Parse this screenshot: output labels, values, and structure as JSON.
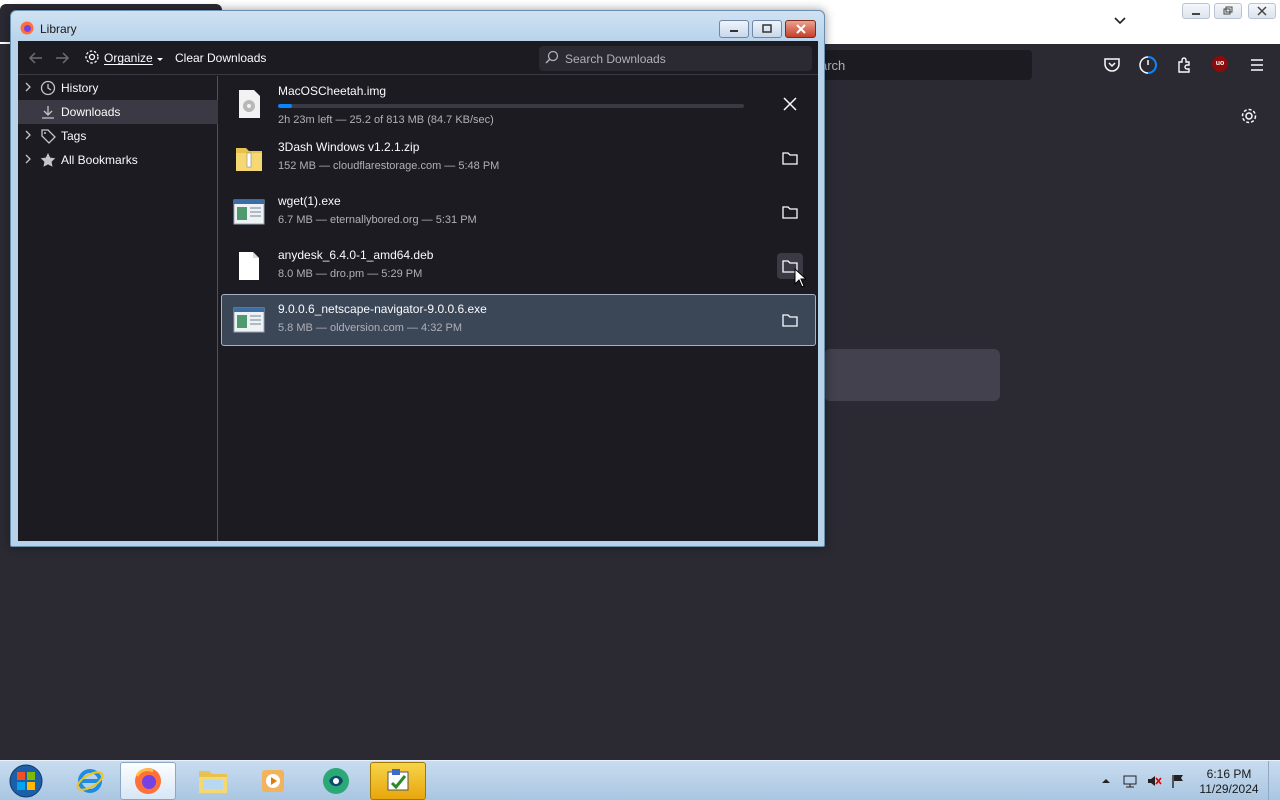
{
  "background_browser": {
    "url_bar_text": "arch",
    "icons": [
      "chevron-down-icon",
      "pocket-icon",
      "firefox-account-icon",
      "extensions-icon",
      "ublock-icon",
      "hamburger-menu-icon",
      "gear-icon"
    ],
    "ublock_badge": "uo"
  },
  "library_window": {
    "title": "Library",
    "toolbar": {
      "organize_label": "Organize",
      "clear_downloads_label": "Clear Downloads",
      "search_placeholder": "Search Downloads"
    },
    "sidebar": {
      "items": [
        {
          "label": "History",
          "icon": "clock-icon",
          "expandable": true,
          "selected": false
        },
        {
          "label": "Downloads",
          "icon": "download-icon",
          "expandable": false,
          "selected": true
        },
        {
          "label": "Tags",
          "icon": "tag-icon",
          "expandable": true,
          "selected": false
        },
        {
          "label": "All Bookmarks",
          "icon": "star-icon",
          "expandable": true,
          "selected": false
        }
      ]
    },
    "downloads": [
      {
        "name": "MacOSCheetah.img",
        "status": "2h 23m left — 25.2 of 813 MB (84.7 KB/sec)",
        "progress_percent": 3.1,
        "in_progress": true,
        "action": "cancel",
        "icon": "disk-image-icon"
      },
      {
        "name": "3Dash Windows v1.2.1.zip",
        "status": "152 MB — cloudflarestorage.com — 5:48 PM",
        "in_progress": false,
        "action": "show-in-folder",
        "icon": "zip-folder-icon"
      },
      {
        "name": "wget(1).exe",
        "status": "6.7 MB — eternallybored.org — 5:31 PM",
        "in_progress": false,
        "action": "show-in-folder",
        "icon": "exe-icon"
      },
      {
        "name": "anydesk_6.4.0-1_amd64.deb",
        "status": "8.0 MB — dro.pm — 5:29 PM",
        "in_progress": false,
        "action": "show-in-folder",
        "icon": "file-icon"
      },
      {
        "name": "9.0.0.6_netscape-navigator-9.0.0.6.exe",
        "status": "5.8 MB — oldversion.com — 4:32 PM",
        "in_progress": false,
        "action": "show-in-folder",
        "icon": "exe-icon",
        "selected": true
      }
    ]
  },
  "taskbar": {
    "apps": [
      "internet-explorer-icon",
      "firefox-icon",
      "file-explorer-icon",
      "media-player-icon",
      "app-green-icon",
      "app-yellow-icon"
    ],
    "clock_time": "6:16 PM",
    "clock_date": "11/29/2024"
  },
  "colors": {
    "accent": "#0a84ff",
    "window_bg": "#1c1b22",
    "selection_bg": "#3b4657"
  }
}
